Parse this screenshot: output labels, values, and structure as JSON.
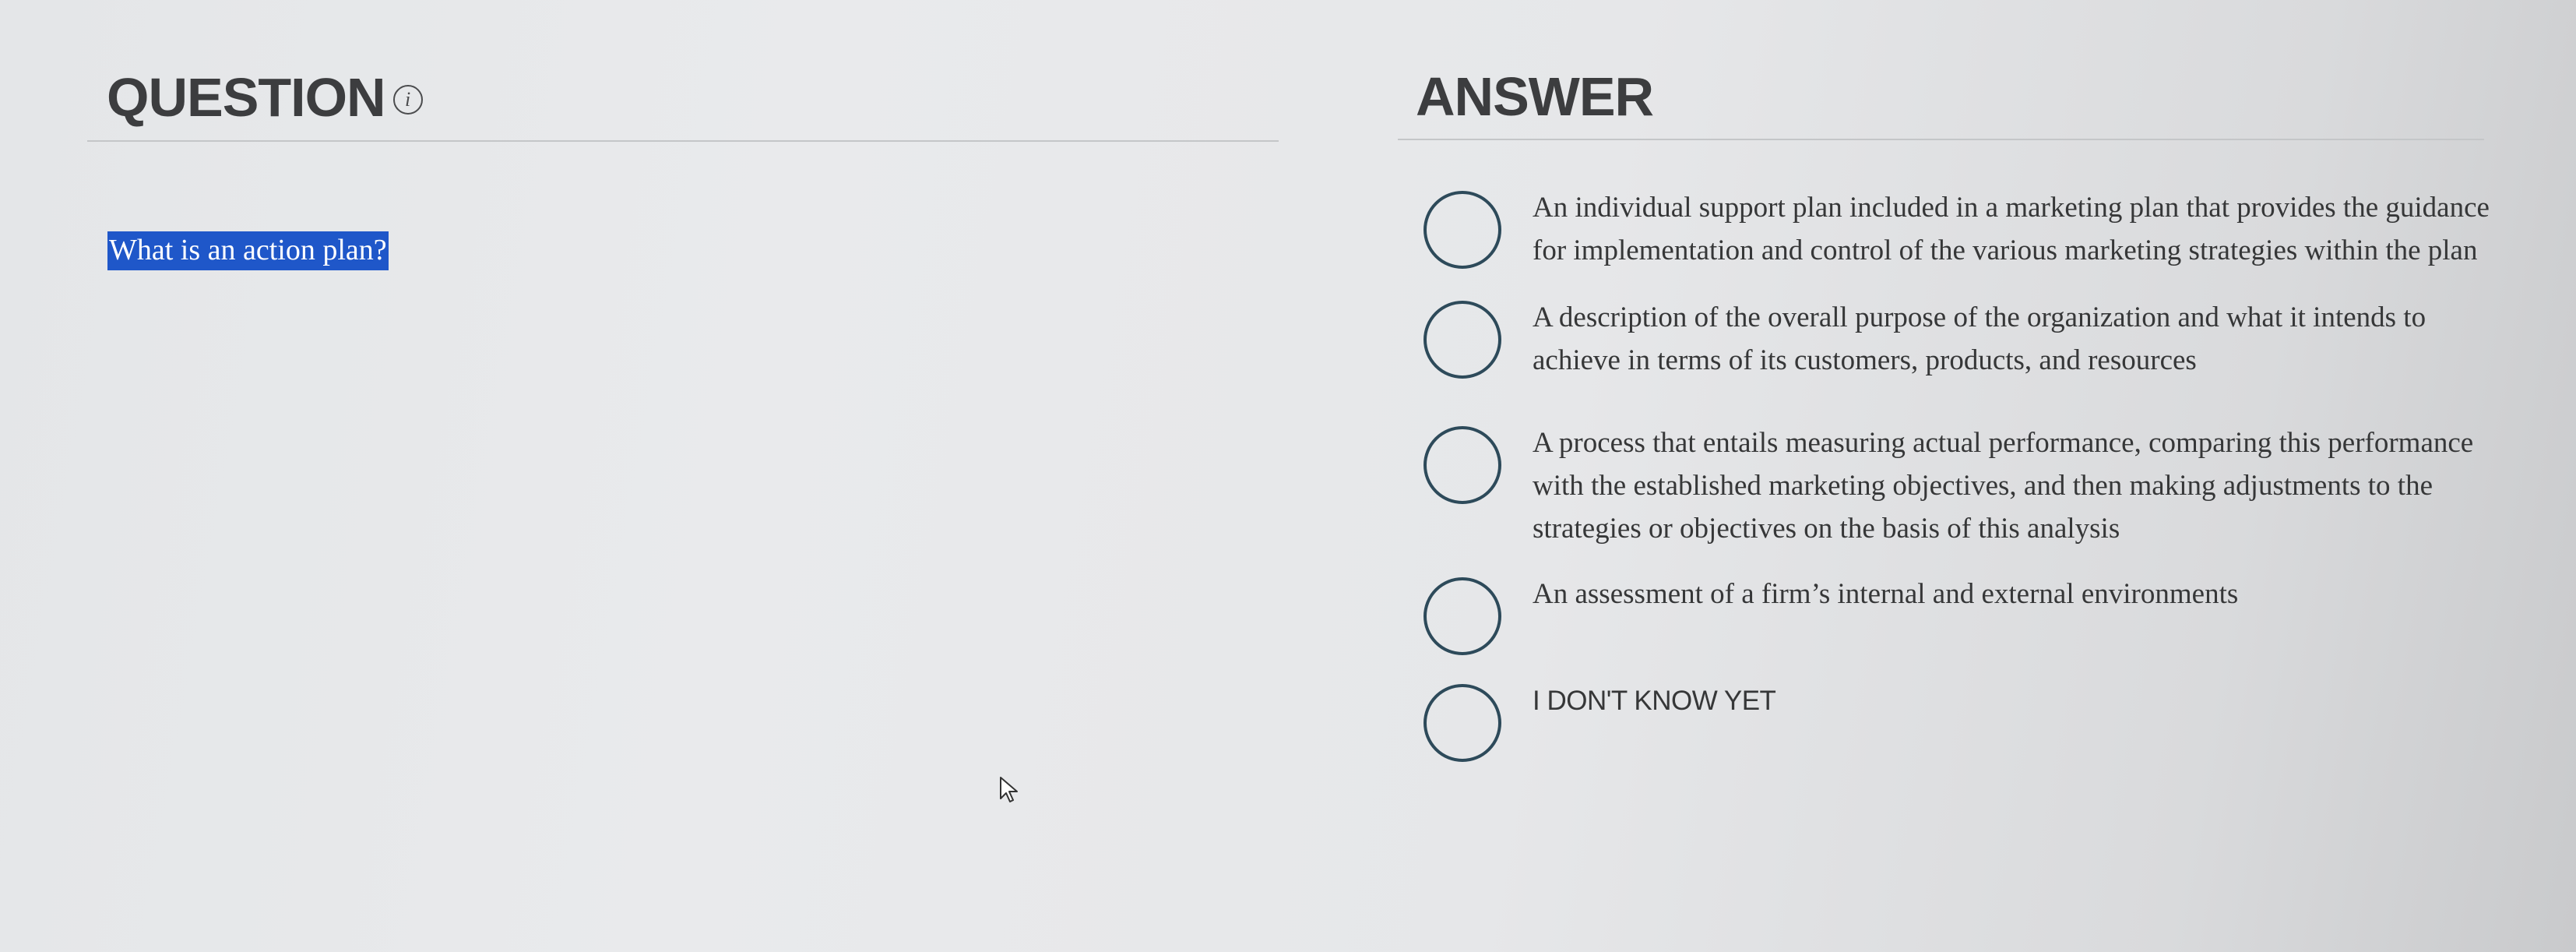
{
  "question_section": {
    "header": "QUESTION",
    "info_icon": "info-icon",
    "question": "What is an action plan?"
  },
  "answer_section": {
    "header": "ANSWER",
    "options": [
      {
        "label": "An individual support plan included in a marketing plan that provides the guidance for implementation and control of the various marketing strategies within the plan",
        "selected": false
      },
      {
        "label": "A description of the overall purpose of the organization and what it intends to achieve in terms of its customers, products, and resources",
        "selected": false
      },
      {
        "label": "A process that entails measuring actual performance, comparing this performance with the established marketing objectives, and then making adjustments to the strategies or objectives on the basis of this analysis",
        "selected": false
      },
      {
        "label": "An assessment of a firm’s internal and external environments",
        "selected": false
      },
      {
        "label": "I DON'T KNOW YET",
        "selected": false
      }
    ]
  },
  "colors": {
    "highlight": "#1f57c9",
    "radio_border": "#2d4a5a",
    "header_text": "#3c3d3f"
  }
}
